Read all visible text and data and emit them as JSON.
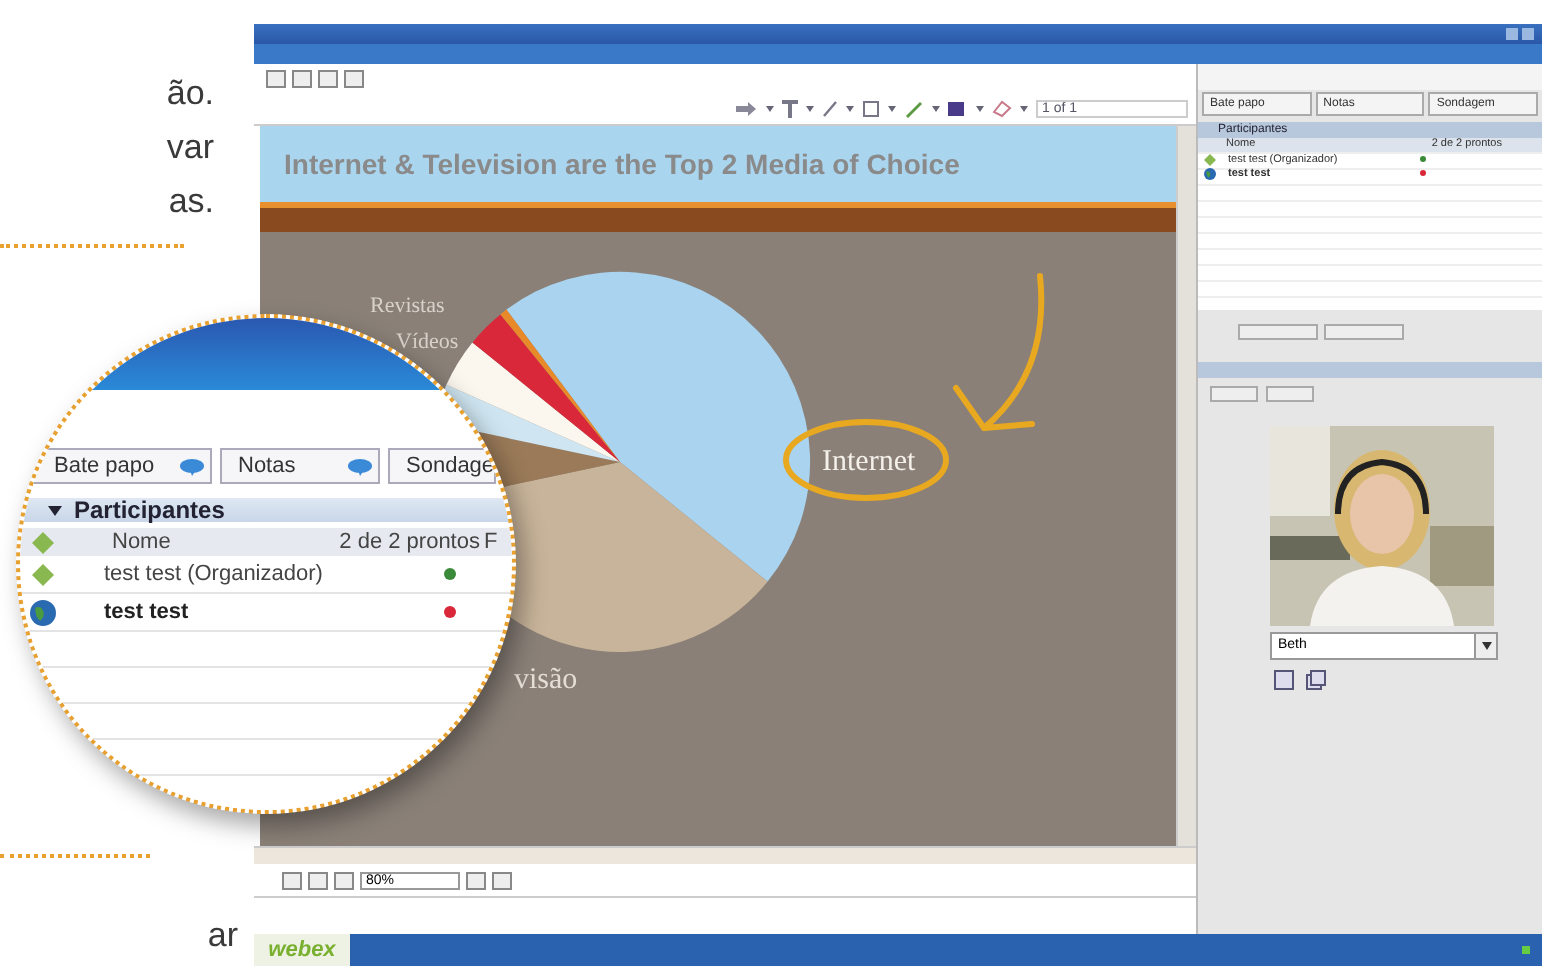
{
  "side_text": {
    "lines": [
      "ão.",
      "var",
      "as."
    ],
    "bottom": "ar"
  },
  "app": {
    "toolbar": {
      "page": "1 of 1"
    },
    "slide": {
      "title": "Internet & Television are the Top 2 Media of Choice",
      "labels": [
        "Revistas",
        "Vídeos"
      ],
      "callout": "Internet",
      "partial_label": "visão"
    },
    "bottom_toolbar": {
      "zoom": "80%"
    },
    "panel_tabs": [
      {
        "label": "Bate papo"
      },
      {
        "label": "Notas"
      },
      {
        "label": "Sondagem"
      }
    ],
    "participants": {
      "title": "Participantes",
      "columns": [
        "Nome",
        "2 de 2 prontos"
      ],
      "rows": [
        {
          "name": "test test (Organizador)",
          "kind": "organizer",
          "color": "#3a8a3a"
        },
        {
          "name": "test test",
          "kind": "attendee",
          "color": "#d8283a"
        }
      ]
    },
    "video": {
      "name": "Beth"
    },
    "status_bar": {
      "logo": "webex"
    }
  },
  "magnifier": {
    "tabs": [
      {
        "label": "Bate papo"
      },
      {
        "label": "Notas"
      },
      {
        "label": "Sondage"
      }
    ],
    "title": "Participantes",
    "columns": [
      "Nome",
      "2 de 2 prontos",
      "F"
    ],
    "rows": [
      {
        "name": "test test (Organizador)",
        "kind": "organizer",
        "color": "#3a8a3a"
      },
      {
        "name": "test test",
        "kind": "attendee",
        "color": "#d8283a"
      }
    ]
  }
}
